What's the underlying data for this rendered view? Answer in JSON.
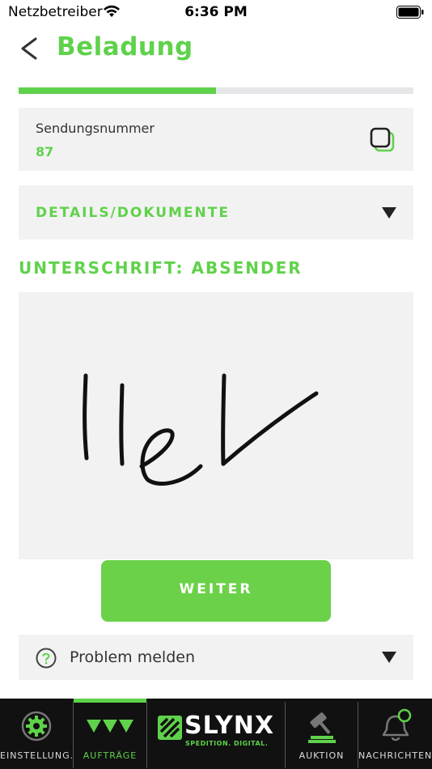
{
  "status_bar": {
    "carrier": "Netzbetreiber",
    "time": "6:36 PM"
  },
  "header": {
    "title": "Beladung"
  },
  "progress": {
    "value": 0.5
  },
  "shipment": {
    "label": "Sendungsnummer",
    "value": "87"
  },
  "details": {
    "label": "DETAILS/DOKUMENTE"
  },
  "signature": {
    "title": "UNTERSCHRIFT: ABSENDER"
  },
  "continue_button": {
    "label": "WEITER"
  },
  "problem": {
    "label": "Problem melden"
  },
  "tabs": [
    {
      "label": "EINSTELLUNG...",
      "icon": "gear-icon"
    },
    {
      "label": "AUFTRÄGE",
      "icon": "orders-icon",
      "active": true
    },
    {
      "label": "SLYNX",
      "sublabel": "SPEDITION. DIGITAL.",
      "icon": "slynx-logo"
    },
    {
      "label": "AUKTION",
      "icon": "gavel-icon"
    },
    {
      "label": "NACHRICHTEN",
      "icon": "bell-icon"
    }
  ],
  "colors": {
    "accent": "#5fd24b",
    "card": "#f2f2f2",
    "tabbar": "#111111"
  }
}
